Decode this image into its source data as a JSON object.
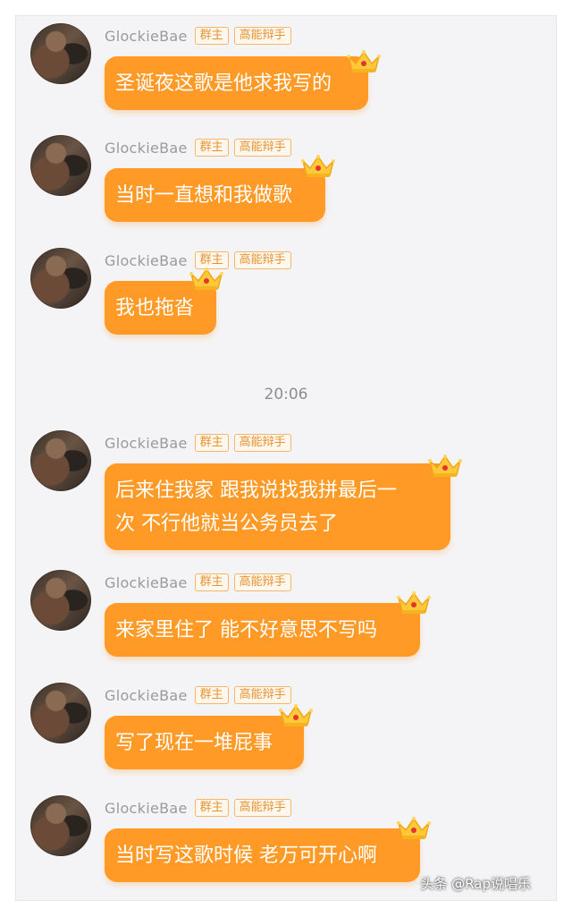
{
  "messages": [
    {
      "name": "GlockieBae",
      "tag_owner": "群主",
      "tag_title": "高能辩手",
      "text": "圣诞夜这歌是他求我写的"
    },
    {
      "name": "GlockieBae",
      "tag_owner": "群主",
      "tag_title": "高能辩手",
      "text": "当时一直想和我做歌"
    },
    {
      "name": "GlockieBae",
      "tag_owner": "群主",
      "tag_title": "高能辩手",
      "text": "我也拖沓"
    },
    {
      "name": "GlockieBae",
      "tag_owner": "群主",
      "tag_title": "高能辩手",
      "text_line1": "后来住我家 跟我说找我拼最后一",
      "text_line2": "次 不行他就当公务员去了"
    },
    {
      "name": "GlockieBae",
      "tag_owner": "群主",
      "tag_title": "高能辩手",
      "text": "来家里住了 能不好意思不写吗"
    },
    {
      "name": "GlockieBae",
      "tag_owner": "群主",
      "tag_title": "高能辩手",
      "text": "写了现在一堆屁事"
    },
    {
      "name": "GlockieBae",
      "tag_owner": "群主",
      "tag_title": "高能辩手",
      "text": "当时写这歌时候 老万可开心啊"
    }
  ],
  "timestamp": "20:06",
  "watermark": "头条 @Rap说唱乐",
  "icons": {
    "crown": "crown-icon",
    "avatar": "avatar"
  },
  "colors": {
    "bubble": "#ff9a27",
    "tag_border": "#f2b66e",
    "tag_text": "#e69433",
    "background": "#f4f4f6"
  }
}
